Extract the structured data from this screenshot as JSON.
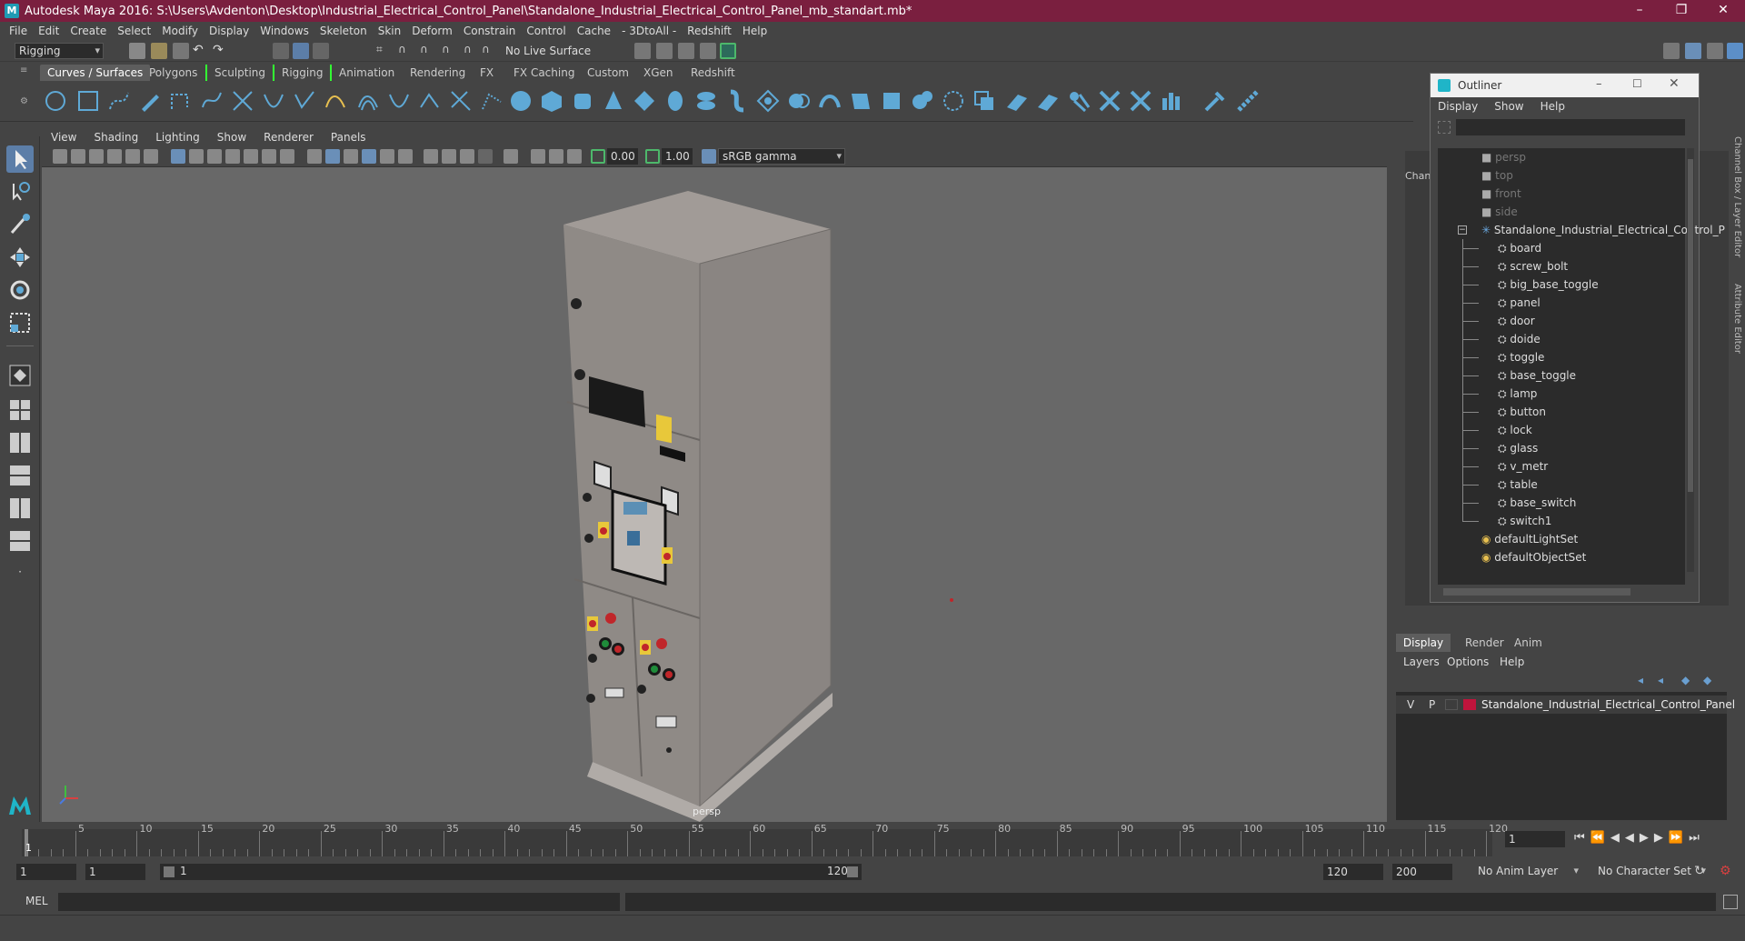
{
  "title": "Autodesk Maya 2016: S:\\Users\\Avdenton\\Desktop\\Industrial_Electrical_Control_Panel\\Standalone_Industrial_Electrical_Control_Panel_mb_standart.mb*",
  "menu": [
    "File",
    "Edit",
    "Create",
    "Select",
    "Modify",
    "Display",
    "Windows",
    "Skeleton",
    "Skin",
    "Deform",
    "Constrain",
    "Control",
    "Cache",
    "- 3DtoAll -",
    "Redshift",
    "Help"
  ],
  "status": {
    "mode": "Rigging",
    "live_surface": "No Live Surface"
  },
  "shelf_tabs": [
    "Curves / Surfaces",
    "Polygons",
    "Sculpting",
    "Rigging",
    "Animation",
    "Rendering",
    "FX",
    "FX Caching",
    "Custom",
    "XGen",
    "Redshift"
  ],
  "viewport": {
    "menu": [
      "View",
      "Shading",
      "Lighting",
      "Show",
      "Renderer",
      "Panels"
    ],
    "exposure": "0.00",
    "gamma": "1.00",
    "color_space": "sRGB gamma",
    "camera_label": "persp"
  },
  "outliner": {
    "title": "Outliner",
    "menu": [
      "Display",
      "Show",
      "Help"
    ],
    "cameras": [
      "persp",
      "top",
      "front",
      "side"
    ],
    "root": "Standalone_Industrial_Electrical_Control_P",
    "children": [
      "board",
      "screw_bolt",
      "big_base_toggle",
      "panel",
      "door",
      "doide",
      "toggle",
      "base_toggle",
      "lamp",
      "button",
      "lock",
      "glass",
      "v_metr",
      "table",
      "base_switch",
      "switch1"
    ],
    "sets": [
      "defaultLightSet",
      "defaultObjectSet"
    ]
  },
  "channel_box_label": "Chann",
  "side_tabs": [
    "Channel Box / Layer Editor",
    "Attribute Editor"
  ],
  "layer_editor": {
    "tabs": [
      "Display",
      "Render",
      "Anim"
    ],
    "menu": [
      "Layers",
      "Options",
      "Help"
    ],
    "layer": {
      "v": "V",
      "p": "P",
      "name": "Standalone_Industrial_Electrical_Control_Panel",
      "color": "#c0143c"
    }
  },
  "timeline": {
    "ticks": [
      "5",
      "10",
      "15",
      "20",
      "25",
      "30",
      "35",
      "40",
      "45",
      "50",
      "55",
      "60",
      "65",
      "70",
      "75",
      "80",
      "85",
      "90",
      "95",
      "100",
      "105",
      "110",
      "115",
      "120"
    ],
    "start": "1",
    "current": "1"
  },
  "range": {
    "start": "1",
    "start2": "1",
    "slider_start": "1",
    "slider_end": "120",
    "end": "120",
    "end2": "200",
    "anim_layer": "No Anim Layer",
    "char_set": "No Character Set"
  },
  "cmd": {
    "label": "MEL"
  },
  "colors": {
    "title_bg": "#7a1f3f",
    "accent": "#5fa9d6",
    "viewport_bg": "#686868"
  }
}
